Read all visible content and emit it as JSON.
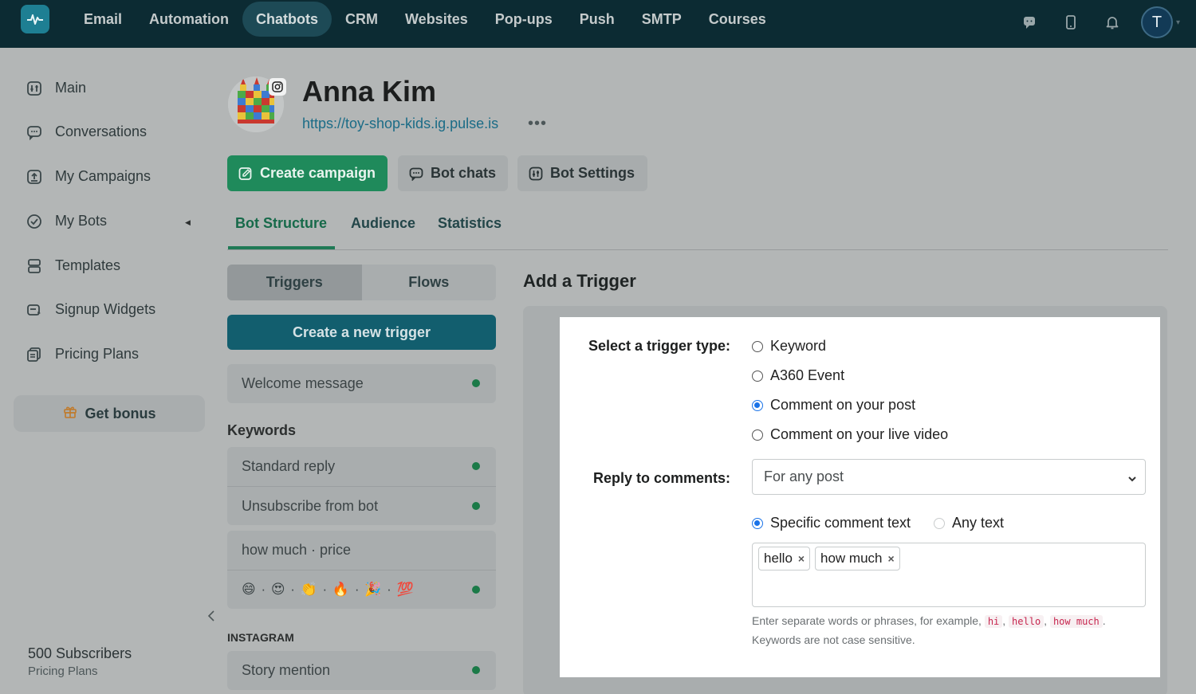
{
  "topnav": {
    "items": [
      "Email",
      "Automation",
      "Chatbots",
      "CRM",
      "Websites",
      "Pop-ups",
      "Push",
      "SMTP",
      "Courses"
    ],
    "active": "Chatbots",
    "avatar_letter": "T"
  },
  "sidebar": {
    "items": [
      {
        "label": "Main",
        "icon": "dashboard-icon"
      },
      {
        "label": "Conversations",
        "icon": "chat-icon"
      },
      {
        "label": "My Campaigns",
        "icon": "upload-icon"
      },
      {
        "label": "My Bots",
        "icon": "bot-icon"
      },
      {
        "label": "Templates",
        "icon": "templates-icon"
      },
      {
        "label": "Signup Widgets",
        "icon": "widget-icon"
      },
      {
        "label": "Pricing Plans",
        "icon": "pricing-icon"
      }
    ],
    "bonus_label": "Get bonus",
    "subscribers": "500 Subscribers",
    "plan_link": "Pricing Plans"
  },
  "profile": {
    "name": "Anna Kim",
    "url": "https://toy-shop-kids.ig.pulse.is",
    "more": "•••"
  },
  "actions": {
    "create_campaign": "Create campaign",
    "bot_chats": "Bot chats",
    "bot_settings": "Bot Settings"
  },
  "tabs": [
    "Bot Structure",
    "Audience",
    "Statistics"
  ],
  "left": {
    "segments": [
      "Triggers",
      "Flows"
    ],
    "new_trigger": "Create a new trigger",
    "welcome": "Welcome message",
    "keywords_heading": "Keywords",
    "keywords": [
      "Standard reply",
      "Unsubscribe from bot"
    ],
    "keyword_group": "how much · price",
    "emoji_row": "😄 · 😍 · 👏 · 🔥 · 🎉 · 💯",
    "instagram_heading": "INSTAGRAM",
    "story_mention": "Story mention"
  },
  "trigger": {
    "title": "Add a Trigger",
    "type_label": "Select a trigger type:",
    "types": [
      "Keyword",
      "A360 Event",
      "Comment on your post",
      "Comment on your live video"
    ],
    "selected_type": "Comment on your post",
    "reply_label": "Reply to comments:",
    "reply_value": "For any post",
    "match_options": [
      "Specific comment text",
      "Any text"
    ],
    "tags": [
      "hello",
      "how much"
    ],
    "help_prefix": "Enter separate words or phrases, for example,",
    "help_examples": [
      "hi",
      "hello",
      "how much"
    ],
    "help_suffix": "Keywords are not case sensitive."
  },
  "colors": {
    "topbar": "#0c2b33",
    "green": "#1f8a5b",
    "teal": "#125e6e",
    "active_dot": "#1b7a48"
  }
}
